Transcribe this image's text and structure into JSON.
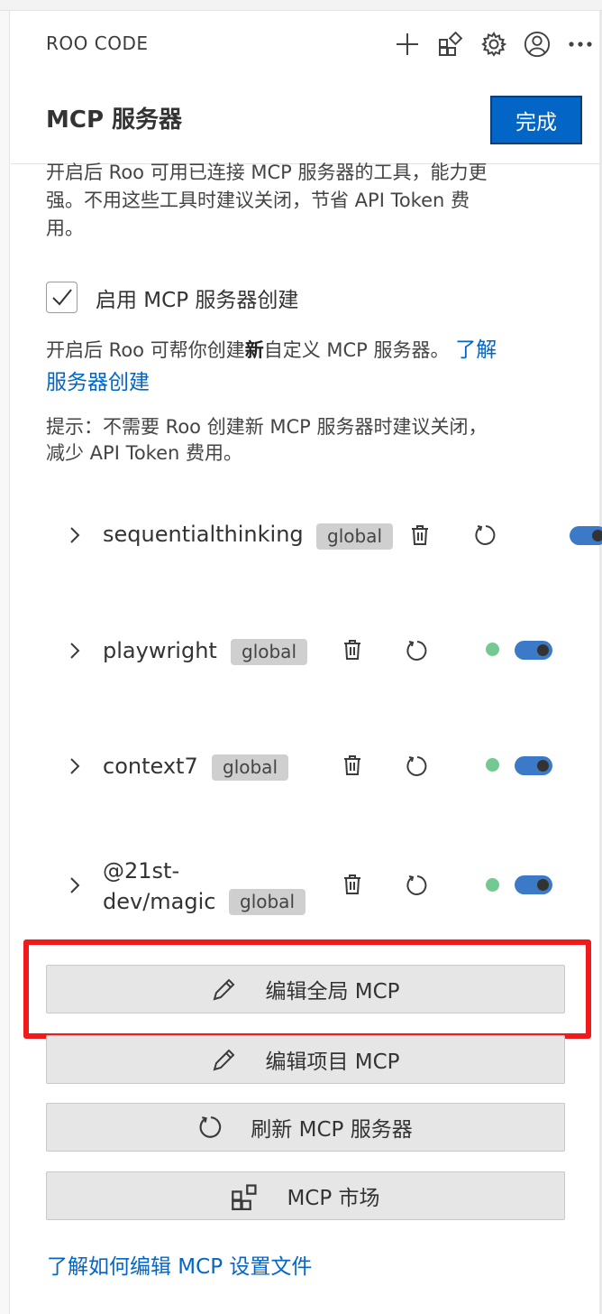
{
  "app": {
    "title": "ROO CODE"
  },
  "toolbar": {
    "icons": [
      "plus-icon",
      "marketplace-icon",
      "gear-icon",
      "account-icon",
      "more-icon"
    ]
  },
  "view": {
    "title": "MCP 服务器",
    "done_label": "完成"
  },
  "description": {
    "line1": "开启后 Roo 可用已连接 MCP 服务器的工具，能力更",
    "line2": "强。不用这些工具时建议关闭，节省 API Token 费",
    "line3": "用。"
  },
  "enable_creation": {
    "checked": true,
    "label": "启用 MCP 服务器创建"
  },
  "creation_info": {
    "text_before": "开启后 Roo 可帮你创建",
    "text_bold": "新",
    "text_after": "自定义 MCP 服务器。 ",
    "link_line1": "了解",
    "link_line2": "服务器创建"
  },
  "tip": {
    "line1": "提示：不需要 Roo 创建新 MCP 服务器时建议关闭，",
    "line2": "减少 API Token 费用。"
  },
  "servers": [
    {
      "name": "sequentialthinking",
      "scope": "global",
      "status_dot": false,
      "enabled": true
    },
    {
      "name": "playwright",
      "scope": "global",
      "status_dot": true,
      "enabled": true
    },
    {
      "name": "context7",
      "scope": "global",
      "status_dot": true,
      "enabled": true
    },
    {
      "name_line1": "@21st-",
      "name_line2": "dev/magic",
      "scope": "global",
      "status_dot": true,
      "enabled": true
    }
  ],
  "actions": {
    "edit_global": "编辑全局 MCP",
    "edit_project": "编辑项目 MCP",
    "refresh": "刷新 MCP 服务器",
    "marketplace": "MCP 市场"
  },
  "footer": {
    "link": "了解如何编辑 MCP 设置文件"
  },
  "colors": {
    "accent": "#0366c6",
    "status_ok": "#73c991",
    "toggle": "#3c79c6",
    "highlight": "#f01a1a"
  }
}
